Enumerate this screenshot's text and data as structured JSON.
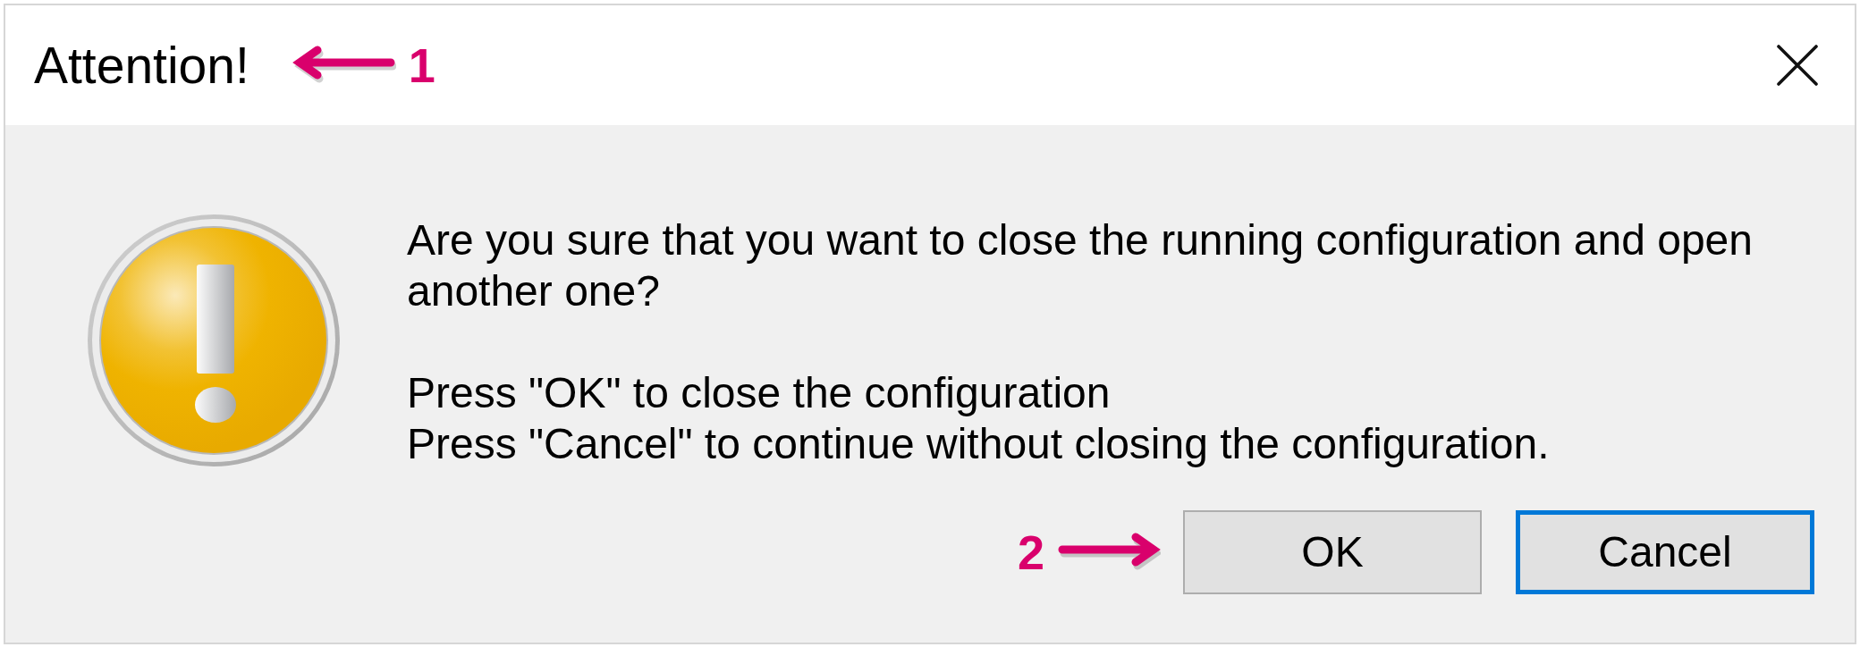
{
  "window": {
    "title": "Attention!",
    "callout": {
      "label": "1",
      "points_left": true
    }
  },
  "message": [
    {
      "lines": [
        "Are you sure that you want to close the running configuration and open another one?"
      ]
    },
    {
      "lines": [
        "Press \"OK\" to close the configuration",
        "Press \"Cancel\" to continue without closing the configuration."
      ]
    }
  ],
  "buttons": [
    {
      "label": "OK",
      "focused": false,
      "callout": {
        "label": "2",
        "points_left": false
      }
    },
    {
      "label": "Cancel",
      "focused": true
    }
  ]
}
